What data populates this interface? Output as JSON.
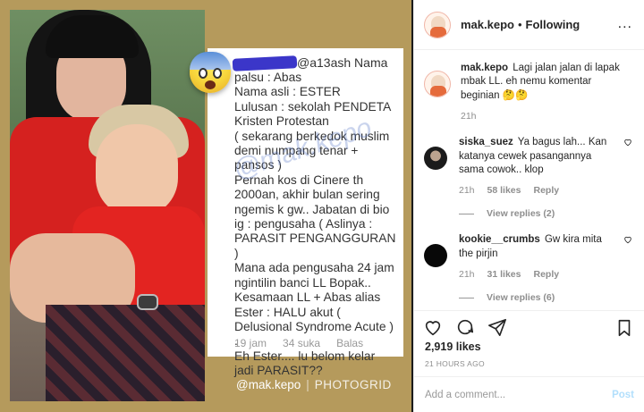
{
  "post_image": {
    "comment": {
      "username": "@a13ash",
      "handle_suffix": "Nama",
      "text": "palsu : Abas\nNama asli : ESTER\nLulusan : sekolah PENDETA Kristen Protestan\n( sekarang berkedok muslim demi numpang tenar + pansos )\nPernah kos di Cinere th 2000an, akhir bulan sering ngemis k gw.. Jabatan di bio ig : pengusaha ( Aslinya : PARASIT PENGANGGURAN )\nMana ada pengusaha 24 jam ngintilin banci LL Bopak..\nKesamaan LL + Abas alias Ester : HALU akut ( Delusional Syndrome Acute )\n.\nEh Ester.... lu belom kelar jadi PARASIT??",
      "time": "19 jam",
      "likes": "34 suka",
      "reply": "Balas"
    },
    "watermark": "@mak.kepo",
    "credit_handle": "@mak.kepo",
    "credit_app": "PHOTOGRID"
  },
  "header": {
    "username": "mak.kepo",
    "dot": "•",
    "following": "Following",
    "more": "..."
  },
  "caption": {
    "username": "mak.kepo",
    "text": "Lagi jalan jalan di lapak mbak LL. eh nemu komentar beginian 🤔🤔",
    "time": "21h"
  },
  "comments": [
    {
      "username": "siska_suez",
      "text": "Ya bagus lah... Kan katanya cewek pasangannya sama cowok.. klop",
      "time": "21h",
      "likes": "58 likes",
      "reply": "Reply",
      "view_replies": "View replies (2)"
    },
    {
      "username": "kookie__crumbs",
      "text": "Gw kira mita the pirjin",
      "time": "21h",
      "likes": "31 likes",
      "reply": "Reply",
      "view_replies": "View replies (6)"
    }
  ],
  "stats": {
    "likes": "2,919 likes",
    "ago": "21 HOURS AGO"
  },
  "add_comment": {
    "placeholder": "Add a comment...",
    "post": "Post"
  },
  "icons": [
    "heart-icon",
    "comment-icon",
    "share-icon",
    "bookmark-icon",
    "more-icon"
  ]
}
